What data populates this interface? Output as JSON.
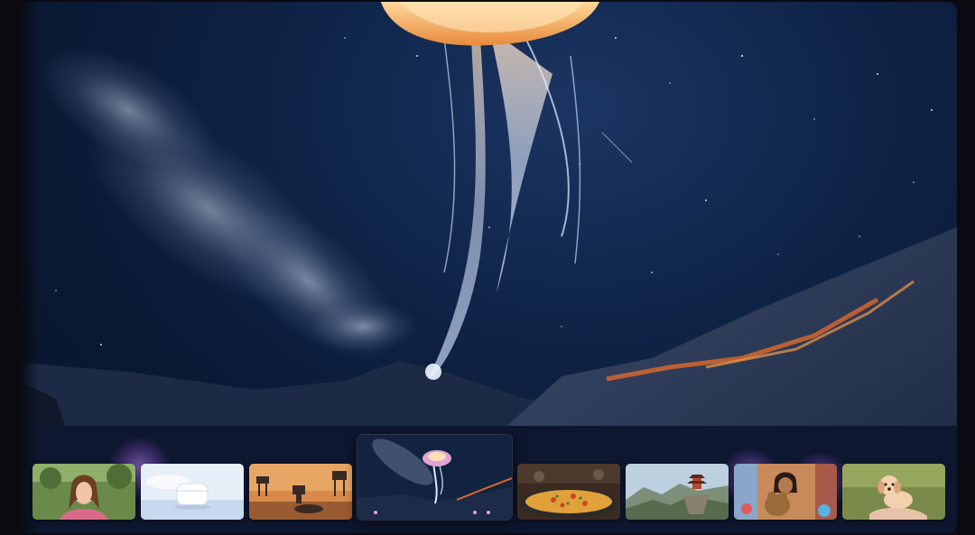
{
  "hero": {
    "icon": "hero-image-jellyfish-night-sky",
    "colors": {
      "sky_top": "#0a1a35",
      "jellyfish_glow": "#f6b46a",
      "tendril": "#dfe9ff",
      "lava": "#e0692a"
    }
  },
  "thumbnails": [
    {
      "icon": "thumb-woman-selfie-garden",
      "active": false
    },
    {
      "icon": "thumb-white-earbuds-case",
      "active": false
    },
    {
      "icon": "thumb-robots-desert-sunset",
      "active": false
    },
    {
      "icon": "thumb-jellyfish-night-sky",
      "active": true
    },
    {
      "icon": "thumb-paella-dish",
      "active": false
    },
    {
      "icon": "thumb-mountain-pagoda",
      "active": false
    },
    {
      "icon": "thumb-girl-with-toys",
      "active": false
    },
    {
      "icon": "thumb-puppy-on-hand",
      "active": false
    }
  ]
}
